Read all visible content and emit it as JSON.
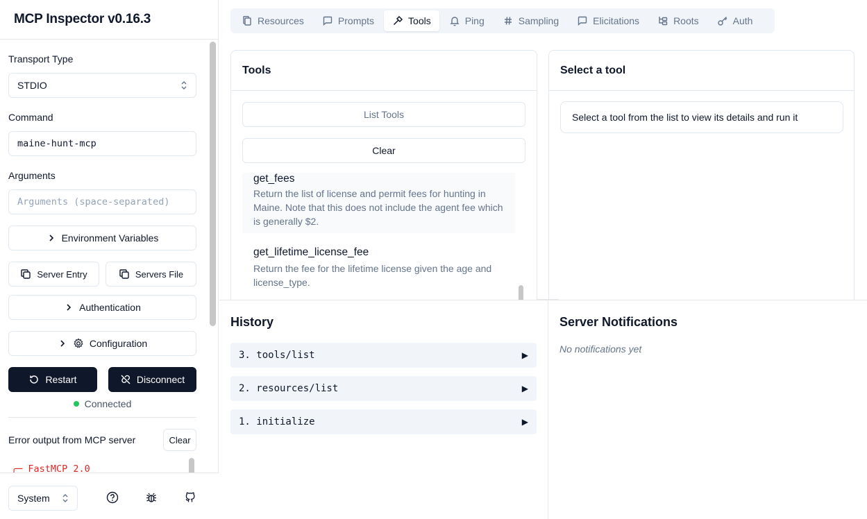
{
  "app": {
    "title": "MCP Inspector v0.16.3"
  },
  "sidebar": {
    "transport_label": "Transport Type",
    "transport_value": "STDIO",
    "command_label": "Command",
    "command_value": "maine-hunt-mcp",
    "arguments_label": "Arguments",
    "arguments_placeholder": "Arguments (space-separated)",
    "env_vars_label": "Environment Variables",
    "server_entry_label": "Server Entry",
    "servers_file_label": "Servers File",
    "authentication_label": "Authentication",
    "configuration_label": "Configuration",
    "restart_label": "Restart",
    "disconnect_label": "Disconnect",
    "status_text": "Connected",
    "status_color": "#22c55e",
    "error_title": "Error output from MCP server",
    "error_clear_label": "Clear",
    "error_text": "╭─ FastMCP 2.0"
  },
  "footer": {
    "theme_value": "System",
    "icons": [
      "help-icon",
      "bug-icon",
      "github-icon"
    ]
  },
  "tabs": [
    {
      "label": "Resources",
      "icon": "files-icon",
      "active": false
    },
    {
      "label": "Prompts",
      "icon": "message-icon",
      "active": false
    },
    {
      "label": "Tools",
      "icon": "hammer-icon",
      "active": true
    },
    {
      "label": "Ping",
      "icon": "bell-icon",
      "active": false
    },
    {
      "label": "Sampling",
      "icon": "hash-icon",
      "active": false
    },
    {
      "label": "Elicitations",
      "icon": "message-icon",
      "active": false
    },
    {
      "label": "Roots",
      "icon": "folder-tree-icon",
      "active": false
    },
    {
      "label": "Auth",
      "icon": "key-icon",
      "active": false
    }
  ],
  "tools_panel": {
    "title": "Tools",
    "list_button": "List Tools",
    "clear_button": "Clear",
    "items": [
      {
        "name": "get_fees",
        "description": "Return the list of license and permit fees for hunting in Maine. Note that this does not include the agent fee which is generally $2."
      },
      {
        "name": "get_lifetime_license_fee",
        "description": "Return the fee for the lifetime license given the age and license_type."
      }
    ]
  },
  "detail_panel": {
    "title": "Select a tool",
    "message": "Select a tool from the list to view its details and run it"
  },
  "history": {
    "title": "History",
    "items": [
      "3. tools/list",
      "2. resources/list",
      "1. initialize"
    ],
    "expand_glyph": "▶"
  },
  "notifications": {
    "title": "Server Notifications",
    "empty_text": "No notifications yet"
  }
}
